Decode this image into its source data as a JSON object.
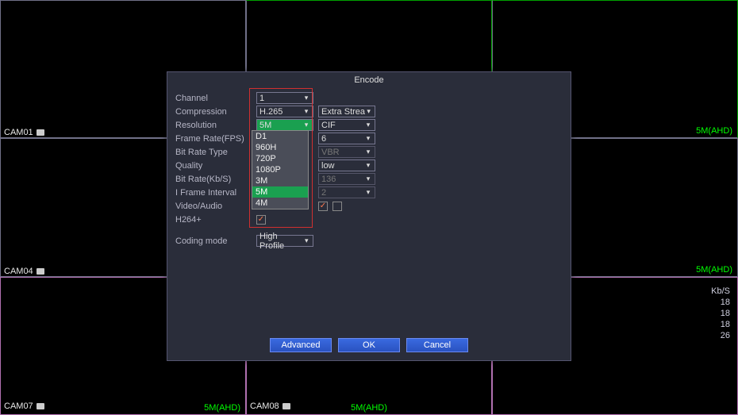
{
  "background": {
    "cam_label": "5M(AHD)",
    "cams": [
      "CAM01",
      "CAM04",
      "CAM07",
      "CAM08"
    ],
    "kbps_header": "Kb/S",
    "kbps": [
      "18",
      "18",
      "18",
      "26"
    ]
  },
  "dialog": {
    "title": "Encode",
    "labels": {
      "channel": "Channel",
      "compression": "Compression",
      "resolution": "Resolution",
      "fps": "Frame Rate(FPS)",
      "brtype": "Bit Rate Type",
      "quality": "Quality",
      "brkbs": "Bit Rate(Kb/S)",
      "iframe": "I Frame Interval",
      "va": "Video/Audio",
      "h264p": "H264+",
      "coding": "Coding mode"
    },
    "main": {
      "channel": "1",
      "compression": "H.265",
      "resolution": "5M",
      "coding": "High Profile"
    },
    "sub": {
      "compression": "Extra Stream",
      "resolution": "CIF",
      "fps": "6",
      "brtype": "VBR",
      "quality": "low",
      "brkbs": "136",
      "iframe": "2"
    },
    "resolution_options": [
      "D1",
      "960H",
      "720P",
      "1080P",
      "3M",
      "5M",
      "4M"
    ],
    "buttons": {
      "advanced": "Advanced",
      "ok": "OK",
      "cancel": "Cancel"
    }
  }
}
